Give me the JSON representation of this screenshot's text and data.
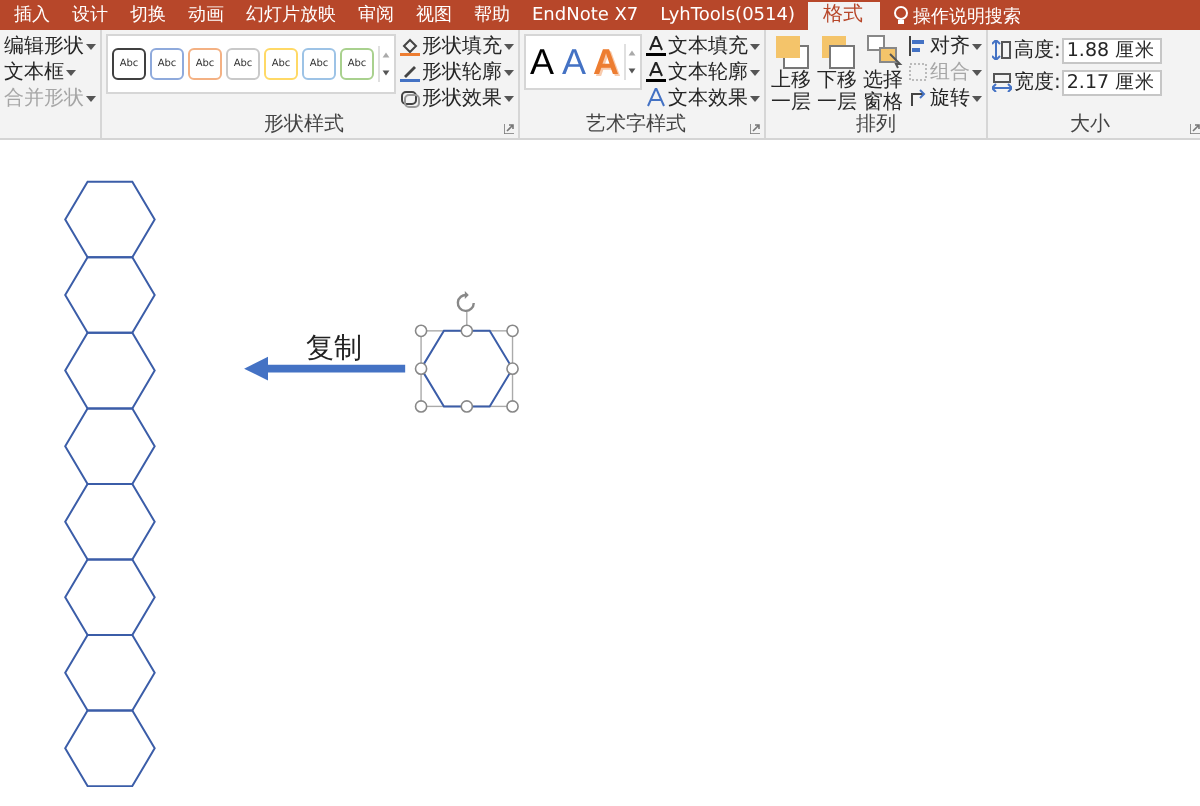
{
  "tabs": [
    {
      "label": "插入",
      "selected": false
    },
    {
      "label": "设计",
      "selected": false
    },
    {
      "label": "切换",
      "selected": false
    },
    {
      "label": "动画",
      "selected": false
    },
    {
      "label": "幻灯片放映",
      "selected": false
    },
    {
      "label": "审阅",
      "selected": false
    },
    {
      "label": "视图",
      "selected": false
    },
    {
      "label": "帮助",
      "selected": false
    },
    {
      "label": "EndNote X7",
      "selected": false
    },
    {
      "label": "LyhTools(0514)",
      "selected": false
    },
    {
      "label": "格式",
      "selected": true
    }
  ],
  "search": {
    "label": "操作说明搜索"
  },
  "insert_shapes": {
    "items": [
      {
        "label": "编辑形状",
        "disabled": false
      },
      {
        "label": "文本框",
        "disabled": false
      },
      {
        "label": "合并形状",
        "disabled": true
      }
    ]
  },
  "shape_styles": {
    "label": "形状样式",
    "presets": [
      {
        "label": "Abc",
        "color": "#404040"
      },
      {
        "label": "Abc",
        "color": "#8faadc"
      },
      {
        "label": "Abc",
        "color": "#f4b183"
      },
      {
        "label": "Abc",
        "color": "#c9c9c9"
      },
      {
        "label": "Abc",
        "color": "#ffd966"
      },
      {
        "label": "Abc",
        "color": "#9dc3e6"
      },
      {
        "label": "Abc",
        "color": "#a9d18e"
      }
    ],
    "commands": [
      {
        "label": "形状填充",
        "kind": "fill"
      },
      {
        "label": "形状轮廓",
        "kind": "outline"
      },
      {
        "label": "形状效果",
        "kind": "effect"
      }
    ]
  },
  "wordart_styles": {
    "label": "艺术字样式",
    "presets": [
      {
        "label": "A",
        "kind": "fill",
        "color": "#000000"
      },
      {
        "label": "A",
        "kind": "fill",
        "color": "#4472c4"
      },
      {
        "label": "A",
        "kind": "outline",
        "color": "#ed7d31"
      }
    ],
    "commands": [
      {
        "label": "文本填充",
        "kind": "fill"
      },
      {
        "label": "文本轮廓",
        "kind": "outline"
      },
      {
        "label": "文本效果",
        "kind": "effect"
      }
    ]
  },
  "arrange": {
    "label": "排列",
    "buttons": [
      {
        "label": "上移一层",
        "kind": "forward"
      },
      {
        "label": "下移一层",
        "kind": "backward"
      },
      {
        "label": "选择窗格",
        "kind": "pane"
      }
    ],
    "commands": [
      {
        "label": "对齐",
        "kind": "align",
        "disabled": false
      },
      {
        "label": "组合",
        "kind": "group",
        "disabled": true
      },
      {
        "label": "旋转",
        "kind": "rotate",
        "disabled": false
      }
    ]
  },
  "size": {
    "label": "大小",
    "fields": [
      {
        "label": "高度:",
        "value": "1.88 厘米",
        "kind": "height"
      },
      {
        "label": "宽度:",
        "value": "2.17 厘米",
        "kind": "width"
      }
    ]
  },
  "canvas": {
    "caption": "复制"
  }
}
